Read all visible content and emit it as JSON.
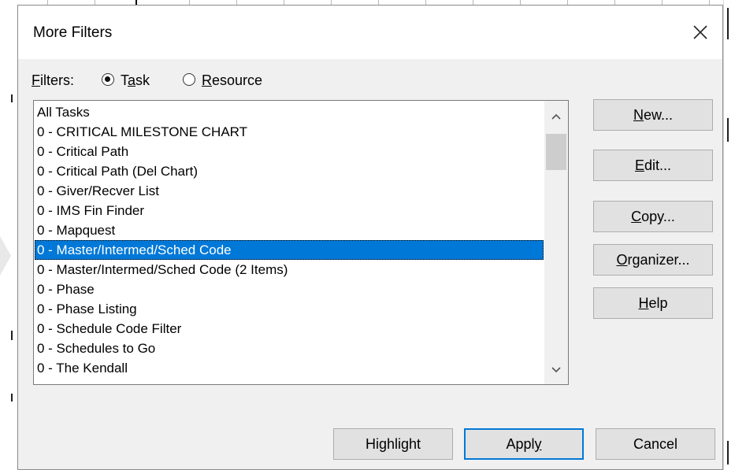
{
  "dialog": {
    "title": "More Filters",
    "close_icon": "close-icon"
  },
  "filter_type": {
    "label_underline": "F",
    "label_rest": "ilters:",
    "options": [
      {
        "pre": "T",
        "underline": "a",
        "post": "sk",
        "selected": true
      },
      {
        "pre": "",
        "underline": "R",
        "post": "esource",
        "selected": false
      }
    ]
  },
  "filter_list": {
    "items": [
      "All Tasks",
      "0 - CRITICAL MILESTONE CHART",
      "0 - Critical Path",
      "0 - Critical Path (Del Chart)",
      "0 - Giver/Recver List",
      "0 - IMS Fin Finder",
      "0 - Mapquest",
      "0 - Master/Intermed/Sched Code",
      "0 - Master/Intermed/Sched Code (2 Items)",
      "0 - Phase",
      "0 - Phase Listing",
      "0 - Schedule Code Filter",
      "0 - Schedules to Go",
      "0 - The Kendall"
    ],
    "selected_index": 7,
    "scroll_up_icon": "chevron-up-icon",
    "scroll_down_icon": "chevron-down-icon"
  },
  "side_buttons": {
    "new": {
      "pre": "",
      "underline": "N",
      "post": "ew..."
    },
    "edit": {
      "pre": "",
      "underline": "E",
      "post": "dit..."
    },
    "copy": {
      "pre": "",
      "underline": "C",
      "post": "opy..."
    },
    "organizer": {
      "pre": "",
      "underline": "O",
      "post": "rganizer..."
    },
    "help": {
      "pre": "",
      "underline": "H",
      "post": "elp"
    }
  },
  "bottom_buttons": {
    "highlight": {
      "pre": "Hi",
      "underline": "g",
      "post": "hlight"
    },
    "apply": {
      "pre": "Appl",
      "underline": "y",
      "post": ""
    },
    "cancel": {
      "pre": "Cancel",
      "underline": "",
      "post": ""
    }
  },
  "colors": {
    "selection": "#0078d7",
    "dialog_bg": "#f0f0f0",
    "button_bg": "#e1e1e1"
  }
}
